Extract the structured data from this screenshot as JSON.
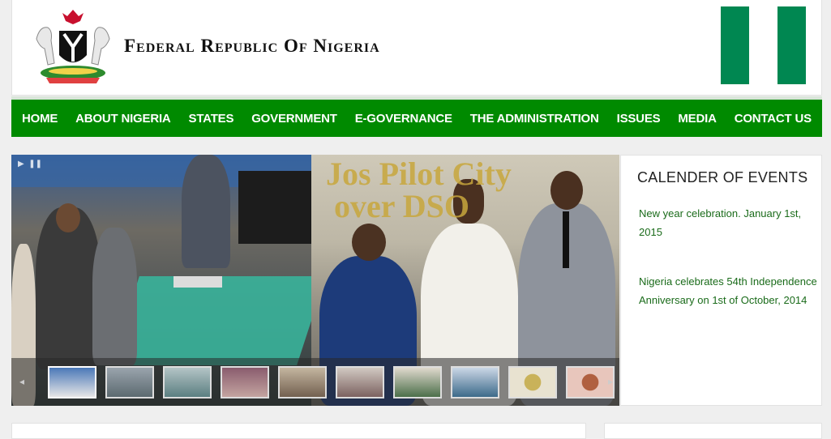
{
  "header": {
    "title": "Federal Republic Of Nigeria",
    "flag_colors": [
      "#008751",
      "#ffffff",
      "#008751"
    ]
  },
  "nav": {
    "items": [
      "HOME",
      "ABOUT NIGERIA",
      "STATES",
      "GOVERNMENT",
      "E-GOVERNANCE",
      "THE ADMINISTRATION",
      "ISSUES",
      "MEDIA",
      "CONTACT US"
    ]
  },
  "slider": {
    "banner_text": "Jos Pilot City\nover DSO",
    "thumbnail_count": 10
  },
  "events": {
    "title": "CALENDER OF EVENTS",
    "items": [
      "New year celebration. January 1st, 2015",
      "Nigeria celebrates 54th Independence Anniversary on 1st of October, 2014"
    ]
  },
  "colors": {
    "nav_green": "#008a00",
    "link_green": "#1a6b1a"
  }
}
